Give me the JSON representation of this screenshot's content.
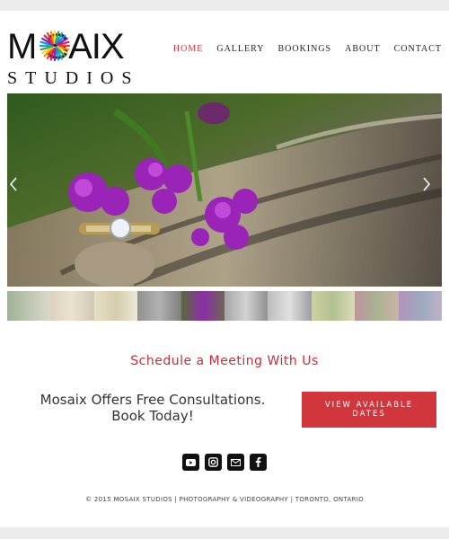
{
  "logo": {
    "word": "M  SAIX",
    "sub": "STUDIOS",
    "burst_colors": [
      "#e53935",
      "#fb8c00",
      "#fdd835",
      "#43a047",
      "#00acc1",
      "#1e88e5",
      "#8e24aa",
      "#d81b60"
    ]
  },
  "nav": {
    "items": [
      {
        "label": "HOME",
        "active": true
      },
      {
        "label": "GALLERY",
        "active": false
      },
      {
        "label": "BOOKINGS",
        "active": false
      },
      {
        "label": "ABOUT",
        "active": false
      },
      {
        "label": "CONTACT",
        "active": false
      }
    ]
  },
  "hero": {
    "prev_icon": "chevron-left-icon",
    "next_icon": "chevron-right-icon"
  },
  "thumbnails": {
    "count": 10,
    "active_index": 5
  },
  "schedule": {
    "heading": "Schedule a Meeting With Us",
    "offer_line1": "Mosaix Offers Free Consultations.",
    "offer_line2": "Book Today!",
    "cta_line1": "VIEW AVAILABLE",
    "cta_line2": "DATES",
    "accent": "#d1363d"
  },
  "social": {
    "icons": [
      "youtube-icon",
      "instagram-icon",
      "email-icon",
      "facebook-icon"
    ]
  },
  "footer": {
    "text": "© 2015 MOSAIX STUDIOS | PHOTOGRAPHY & VIDEOGRAPHY | TORONTO, ONTARIO"
  }
}
